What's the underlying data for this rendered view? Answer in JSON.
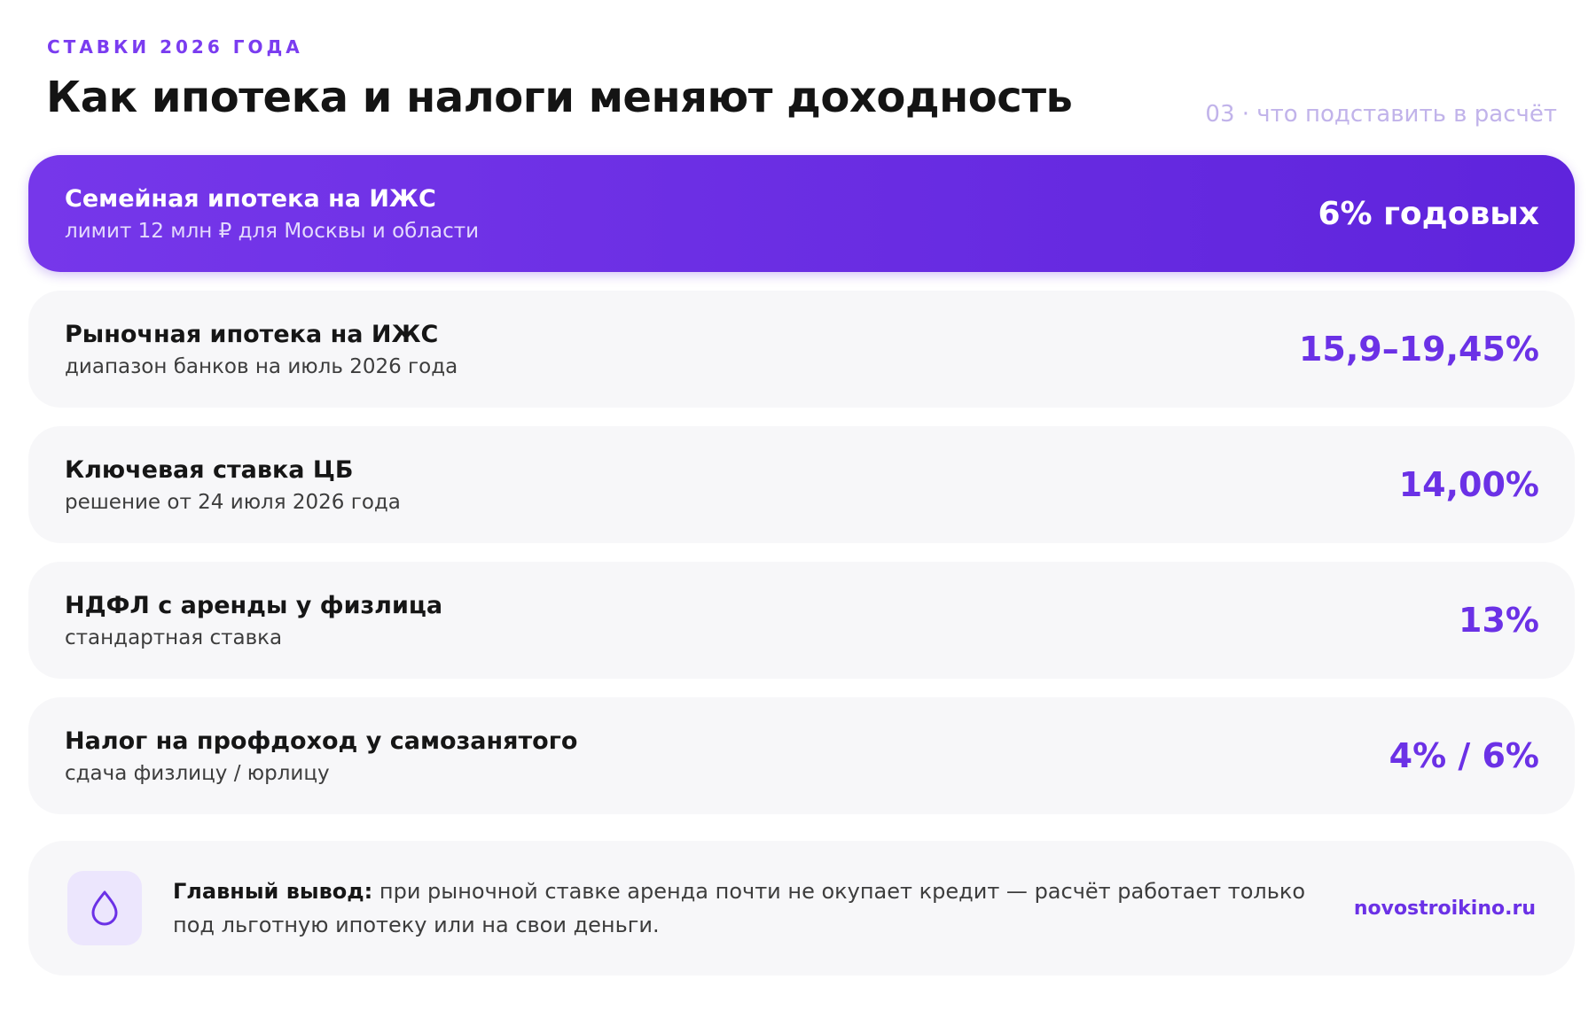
{
  "header": {
    "eyebrow": "СТАВКИ 2026 ГОДА",
    "title": "Как ипотека и налоги меняют доходность",
    "section_note": "03 · что подставить в расчёт"
  },
  "rates": [
    {
      "name": "Семейная ипотека на ИЖС",
      "note": "лимит 12 млн ₽ для Москвы и области",
      "value": "6% годовых",
      "highlight": true
    },
    {
      "name": "Рыночная ипотека на ИЖС",
      "note": "диапазон банков на июль 2026 года",
      "value": "15,9–19,45%"
    },
    {
      "name": "Ключевая ставка ЦБ",
      "note": "решение от 24 июля 2026 года",
      "value": "14,00%"
    },
    {
      "name": "НДФЛ с аренды у физлица",
      "note": "стандартная ставка",
      "value": "13%"
    },
    {
      "name": "Налог на профдоход у самозанятого",
      "note": "сдача физлицу / юрлицу",
      "value": "4% / 6%"
    }
  ],
  "conclusion": {
    "icon": "drop-icon",
    "label": "Главный вывод:",
    "text": " при рыночной ставке аренда почти не окупает кредит — расчёт работает только под льготную ипотеку или на свои деньги.",
    "site": "novostroikino.ru"
  },
  "colors": {
    "accent": "#6b31e6",
    "highlight_start": "#7637ea",
    "highlight_end": "#5f24dc",
    "card_bg": "#f7f7f9",
    "icon_bg": "#ece6fd"
  }
}
